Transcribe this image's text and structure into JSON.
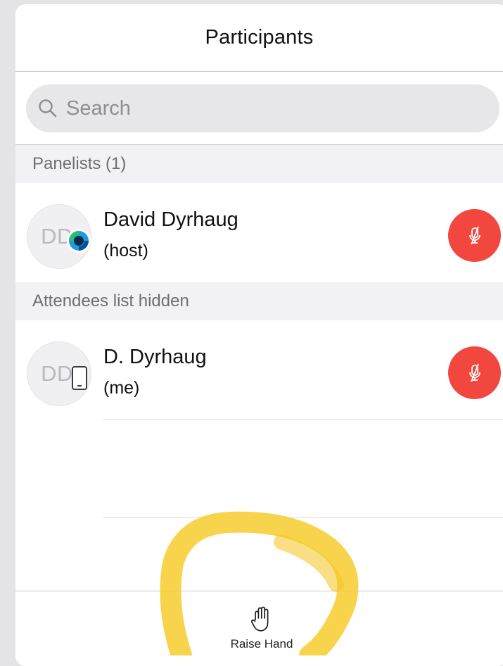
{
  "header": {
    "title": "Participants"
  },
  "search": {
    "placeholder": "Search",
    "icon": "search-icon"
  },
  "sections": {
    "panelists": {
      "label": "Panelists (1)"
    },
    "attendees": {
      "label": "Attendees list hidden"
    }
  },
  "participants": [
    {
      "initials": "DD",
      "name": "David Dyrhaug",
      "role": "(host)",
      "badge": "webex-logo-icon",
      "mic": "muted"
    },
    {
      "initials": "DD",
      "name": "D. Dyrhaug",
      "role": "(me)",
      "badge": "mobile-phone-icon",
      "mic": "muted"
    }
  ],
  "footer": {
    "raise_hand_label": "Raise Hand"
  },
  "colors": {
    "mute_red": "#f2473f",
    "highlight_yellow": "#f7cd2e",
    "section_bg": "#f2f2f4"
  }
}
